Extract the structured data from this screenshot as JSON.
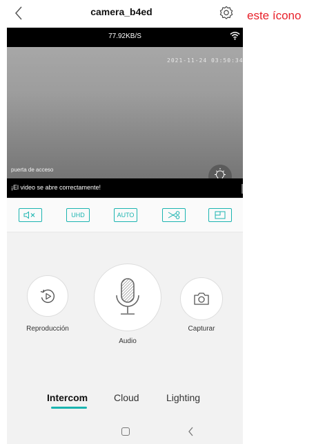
{
  "header": {
    "title": "camera_b4ed",
    "annotation": "este ícono"
  },
  "video": {
    "speed": "77.92KB/S",
    "timestamp": "2021-11-24 03:50:34",
    "camera_label": "puerta de acceso",
    "status_text": "¡El video se abre correctamente!"
  },
  "toolbar": {
    "mute": "🔇",
    "uhd_label": "UHD",
    "auto_label": "AUTO"
  },
  "controls": {
    "playback_label": "Reproducción",
    "audio_label": "Audio",
    "capture_label": "Capturar"
  },
  "tabs": [
    {
      "label": "Intercom",
      "active": true
    },
    {
      "label": "Cloud",
      "active": false
    },
    {
      "label": "Lighting",
      "active": false
    }
  ],
  "colors": {
    "accent": "#1ab4b0",
    "annotation": "#e8202a"
  }
}
